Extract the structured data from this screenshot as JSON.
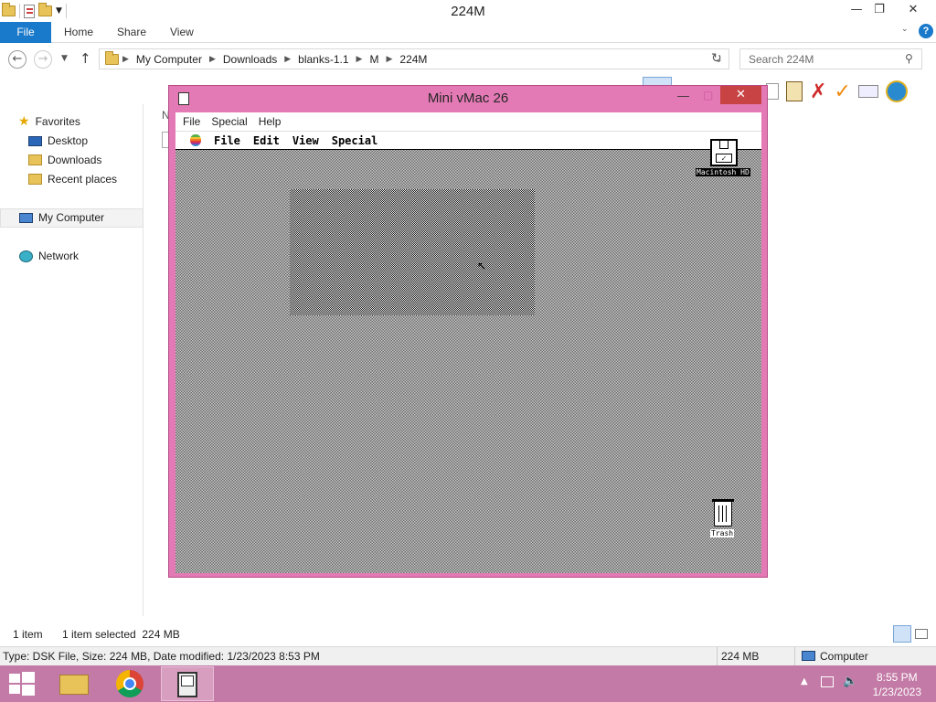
{
  "window": {
    "title": "224M"
  },
  "ribbon": {
    "file": "File",
    "tabs": [
      "Home",
      "Share",
      "View"
    ]
  },
  "address": {
    "crumbs": [
      "My Computer",
      "Downloads",
      "blanks-1.1",
      "M",
      "224M"
    ],
    "search_placeholder": "Search 224M"
  },
  "nav": {
    "favorites": "Favorites",
    "desktop": "Desktop",
    "downloads": "Downloads",
    "recent": "Recent places",
    "computer": "My Computer",
    "network": "Network"
  },
  "content": {
    "truncated_header": "N"
  },
  "status": {
    "items": "1 item",
    "selected": "1 item selected  224 MB",
    "details": "Type: DSK File, Size: 224 MB, Date modified: 1/23/2023 8:53 PM",
    "size": "224 MB",
    "computer": "Computer"
  },
  "vmac": {
    "title": "Mini vMac 26",
    "menu": [
      "File",
      "Special",
      "Help"
    ],
    "mac_menu": [
      "File",
      "Edit",
      "View",
      "Special"
    ],
    "disk_label": "Macintosh HD",
    "trash_label": "Trash"
  },
  "clock": {
    "time": "8:55 PM",
    "date": "1/23/2023"
  },
  "colors": {
    "accent": "#1979ca",
    "vmac_frame": "#e47ab5",
    "taskbar": "#c37aa6",
    "close": "#c84444"
  }
}
